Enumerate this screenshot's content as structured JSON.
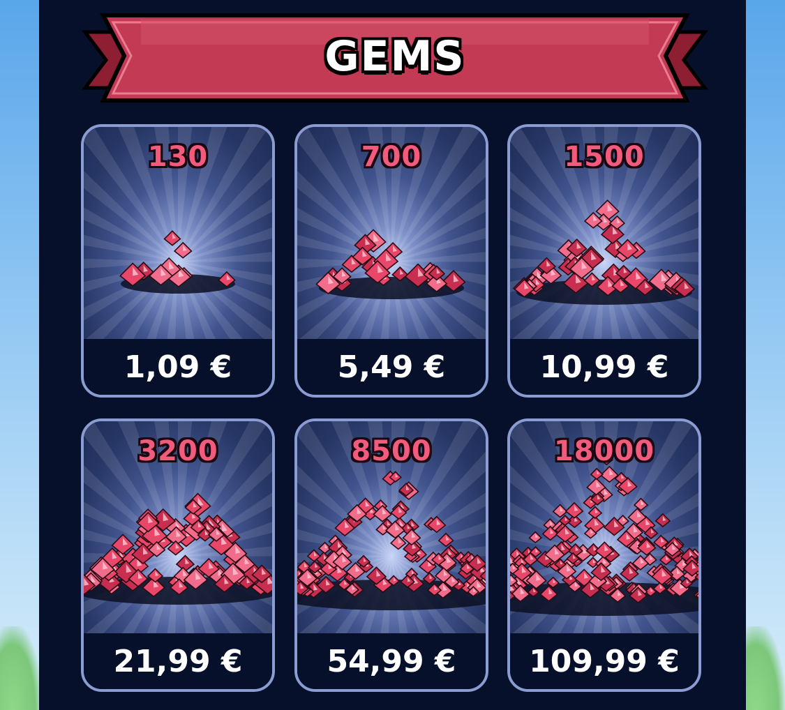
{
  "store": {
    "title": "GEMS",
    "packs": [
      {
        "amount": "130",
        "price": "1,09 €",
        "pile_size": 1
      },
      {
        "amount": "700",
        "price": "5,49 €",
        "pile_size": 2
      },
      {
        "amount": "1500",
        "price": "10,99 €",
        "pile_size": 3
      },
      {
        "amount": "3200",
        "price": "21,99 €",
        "pile_size": 4
      },
      {
        "amount": "8500",
        "price": "54,99 €",
        "pile_size": 5
      },
      {
        "amount": "18000",
        "price": "109,99 €",
        "pile_size": 6
      }
    ]
  },
  "colors": {
    "banner": "#c23a54",
    "amount_text": "#f25b7d",
    "card_border": "#8a9cd2",
    "panel": "#06102a",
    "gem": "#e8476a"
  },
  "icons": [
    "gem-pile-icon"
  ]
}
